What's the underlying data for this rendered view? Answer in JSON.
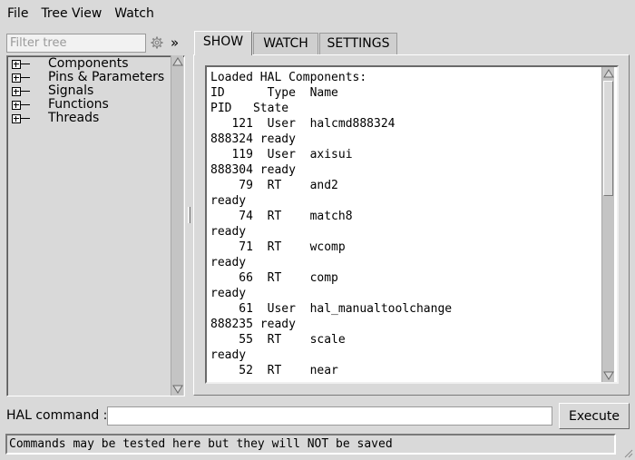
{
  "menubar": {
    "items": [
      "File",
      "Tree View",
      "Watch"
    ]
  },
  "tree": {
    "filter_placeholder": "Filter tree",
    "filter_value": "",
    "settings_icon": "gear-icon",
    "expand_glyph": "»",
    "items": [
      "Components",
      "Pins & Parameters",
      "Signals",
      "Functions",
      "Threads"
    ]
  },
  "tabs": [
    {
      "label": "SHOW",
      "active": true
    },
    {
      "label": "WATCH",
      "active": false
    },
    {
      "label": "SETTINGS",
      "active": false
    }
  ],
  "show": {
    "lines": [
      "Loaded HAL Components:",
      "ID      Type  Name",
      "PID   State",
      "   121  User  halcmd888324",
      "888324 ready",
      "   119  User  axisui",
      "888304 ready",
      "    79  RT    and2",
      "ready",
      "    74  RT    match8",
      "ready",
      "    71  RT    wcomp",
      "ready",
      "    66  RT    comp",
      "ready",
      "    61  User  hal_manualtoolchange",
      "888235 ready",
      "    55  RT    scale",
      "ready",
      "    52  RT    near"
    ]
  },
  "command": {
    "label": "HAL command :",
    "value": "",
    "execute_label": "Execute",
    "status": "Commands may be tested here but they will NOT be saved"
  },
  "colors": {
    "background": "#d9d9d9",
    "text_bg": "#ffffff",
    "scroll_trough": "#c4c4c4"
  }
}
